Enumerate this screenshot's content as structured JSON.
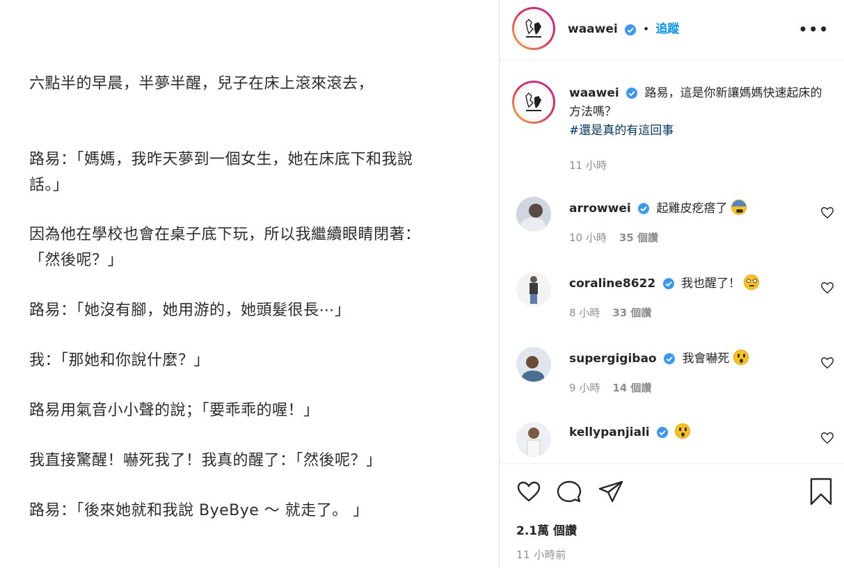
{
  "story": {
    "lines": [
      "六點半的早晨，半夢半醒，兒子在床上滾來滾去，",
      "路易：「媽媽，我昨天夢到一個女生，她在床底下和我說",
      "話。」",
      "因為他在學校也會在桌子底下玩，所以我繼續眼睛閉著：",
      "「然後呢？」",
      "路易：「她沒有腳，她用游的，她頭髮很長⋯」",
      "我：「那她和你說什麼？」",
      "路易用氣音小小聲的說；「要乖乖的喔！」",
      "我直接驚醒！嚇死我了！我真的醒了：「然後呢？」",
      "路易：「後來她就和我說 ByeBye ～ 就走了。 」"
    ]
  },
  "header": {
    "username": "waawei",
    "separator": "•",
    "follow_label": "追蹤",
    "more_label": "•••"
  },
  "caption": {
    "username": "waawei",
    "text": "路易，這是你新讓媽媽快速起床的方法嗎？",
    "hashtag": "#還是真的有這回事",
    "time": "11 小時"
  },
  "comments": [
    {
      "username": "arrowwei",
      "text": "起雞皮疙瘩了",
      "emoji": "fearful-face",
      "time": "10 小時",
      "likes": "35 個讚"
    },
    {
      "username": "coraline8622",
      "text": "我也醒了！",
      "emoji": "flushed-face",
      "time": "8 小時",
      "likes": "33 個讚"
    },
    {
      "username": "supergigibao",
      "text": "我會嚇死",
      "emoji": "astonished-face",
      "time": "9 小時",
      "likes": "14 個讚"
    },
    {
      "username": "kellypanjiali",
      "text": "",
      "emoji": "astonished-face",
      "time": "",
      "likes": ""
    }
  ],
  "footer": {
    "likes_count": "2.1萬 個讚",
    "posted_time": "11 小時前"
  },
  "colors": {
    "link_blue": "#0095f6",
    "hashtag_blue": "#00376b",
    "muted": "#8e8e8e",
    "verified_blue": "#3897f0"
  },
  "icons": [
    "heart-icon",
    "comment-icon",
    "share-icon",
    "bookmark-icon",
    "verified-badge-icon",
    "more-options-icon"
  ]
}
